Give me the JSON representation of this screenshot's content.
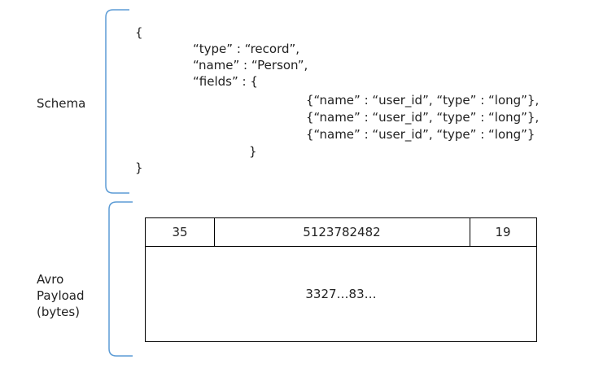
{
  "schema_section": {
    "label": "Schema",
    "lines": [
      "{",
      "“type” : “record”,",
      "“name” : “Person”,",
      "“fields” : {",
      "{“name” : “user_id”, “type” : “long”},",
      "{“name” : “user_id”, “type” : “long”},",
      "{“name” : “user_id”, “type” : “long”}",
      "}",
      "}"
    ]
  },
  "payload_section": {
    "label_lines": [
      "Avro",
      "Payload",
      "(bytes)"
    ],
    "cells": [
      "35",
      "5123782482",
      "19"
    ],
    "body_text": "3327…83…"
  },
  "colors": {
    "brace": "#5b9bd5",
    "box_border": "#000000",
    "text": "#222222"
  }
}
